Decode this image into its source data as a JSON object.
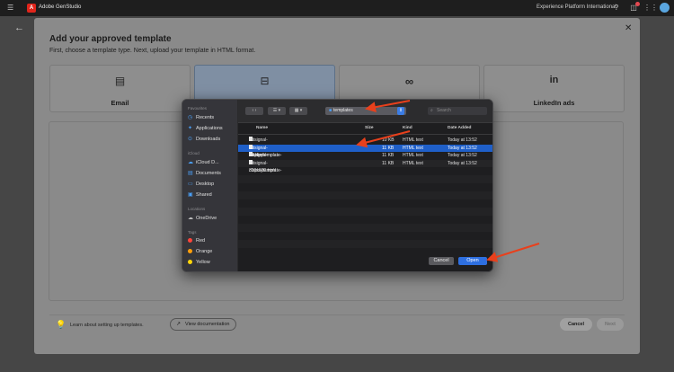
{
  "topbar": {
    "app_name": "Adobe GenStudio",
    "org_name": "Experience Platform International",
    "icons": [
      "menu-icon",
      "help-icon",
      "notifications-icon",
      "apps-grid-icon",
      "avatar"
    ]
  },
  "modal": {
    "title": "Add your approved template",
    "subtitle": "First, choose a template type. Next, upload your template in HTML format.",
    "cards": [
      {
        "label": "Email",
        "icon": "email-icon"
      },
      {
        "label": "",
        "icon": "display-icon"
      },
      {
        "label": "",
        "icon": "meta-icon"
      },
      {
        "label": "LinkedIn ads",
        "icon": "linkedin-icon"
      }
    ],
    "hint": "Learn about setting up templates.",
    "view_docs": "View documentation",
    "cancel": "Cancel",
    "next": "Next"
  },
  "dialog": {
    "sidebar": {
      "favorites_header": "Favourites",
      "favorites": [
        "Recents",
        "Applications",
        "Downloads"
      ],
      "icloud_header": "iCloud",
      "icloud": [
        "iCloud D...",
        "Documents",
        "Desktop",
        "Shared"
      ],
      "locations_header": "Locations",
      "locations": [
        "OneDrive"
      ],
      "tags_header": "Tags",
      "tags": [
        {
          "name": "Red",
          "color": "#ff453a"
        },
        {
          "name": "Orange",
          "color": "#ff9f0a"
        },
        {
          "name": "Yellow",
          "color": "#ffd60a"
        }
      ]
    },
    "location": "templates",
    "search_placeholder": "Search",
    "columns": {
      "name": "Name",
      "size": "Size",
      "kind": "Kind",
      "date": "Date Added"
    },
    "files": [
      {
        "name": "citisignal-meta-ad.html",
        "size": "10 KB",
        "kind": "HTML text",
        "date": "Today at 13:52"
      },
      {
        "name": "citisignal-displaytemplate-970x250.html",
        "size": "11 KB",
        "kind": "HTML text",
        "date": "Today at 13:52",
        "selected": true
      },
      {
        "name": "citisignal-displaytemplate-300x600.html",
        "size": "11 KB",
        "kind": "HTML text",
        "date": "Today at 13:52"
      },
      {
        "name": "citisignal-displaytemplate-300x250.html",
        "size": "11 KB",
        "kind": "HTML text",
        "date": "Today at 13:52"
      }
    ],
    "cancel": "Cancel",
    "open": "Open"
  },
  "colors": {
    "accent": "#2e6fe0",
    "annotation": "#e8401c",
    "selection": "#1f5fc8"
  }
}
